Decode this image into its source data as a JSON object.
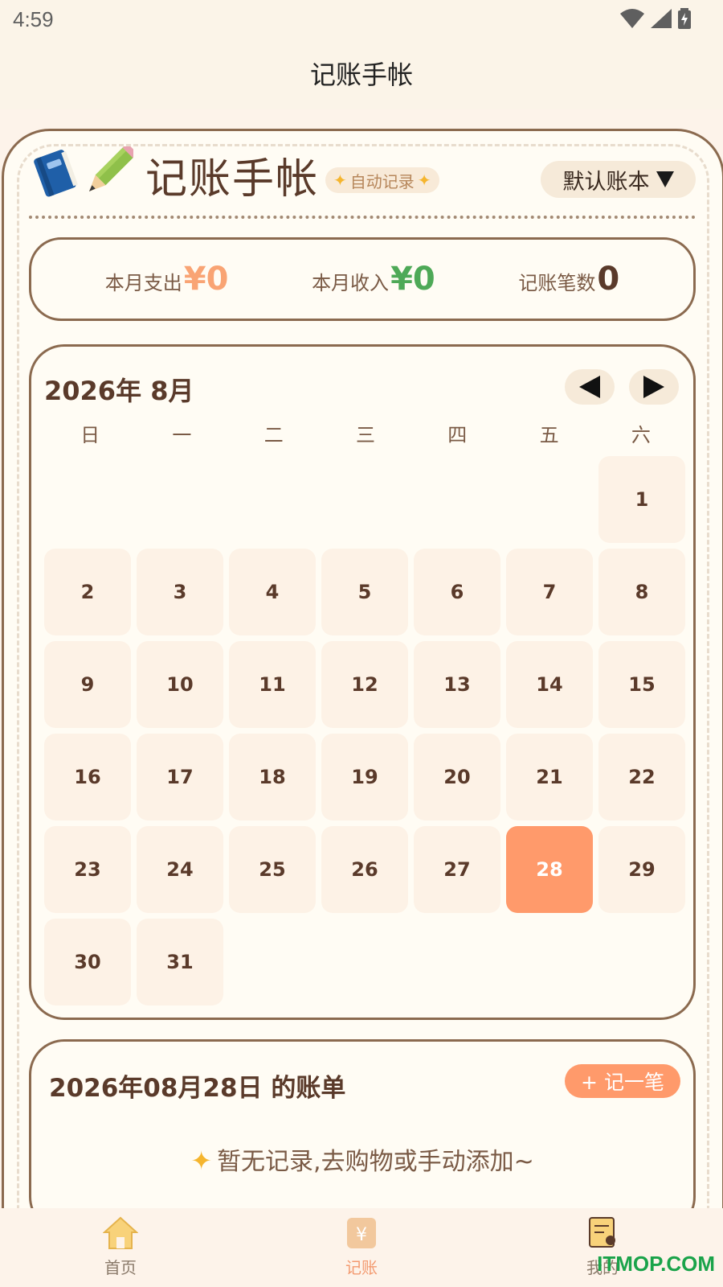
{
  "status_bar": {
    "time": "4:59"
  },
  "app_bar": {
    "title": "记账手帐"
  },
  "header": {
    "title": "记账手帐",
    "auto_badge": "自动记录",
    "ledger_select": "默认账本"
  },
  "stats": [
    {
      "label": "本月支出",
      "value": "¥0"
    },
    {
      "label": "本月收入",
      "value": "¥0"
    },
    {
      "label": "记账笔数",
      "value": "0"
    }
  ],
  "calendar": {
    "title": "2026年 8月",
    "weekdays": [
      "日",
      "一",
      "二",
      "三",
      "四",
      "五",
      "六"
    ],
    "first_weekday_index": 6,
    "days_in_month": 31,
    "selected_day": 28
  },
  "bill": {
    "title": "2026年08月28日 的账单",
    "add_button": "+ 记一笔",
    "empty_text": "暂无记录,去购物或手动添加~"
  },
  "tabs": [
    {
      "label": "首页",
      "icon": "home-icon",
      "active": false
    },
    {
      "label": "记账",
      "icon": "ledger-icon",
      "active": true
    },
    {
      "label": "我的",
      "icon": "profile-icon",
      "active": false
    }
  ],
  "watermark": "ITMOP.COM",
  "colors": {
    "accent": "#ff9a6b",
    "border": "#8b6a4f",
    "income": "#4ea957",
    "expense": "#f9a474"
  }
}
